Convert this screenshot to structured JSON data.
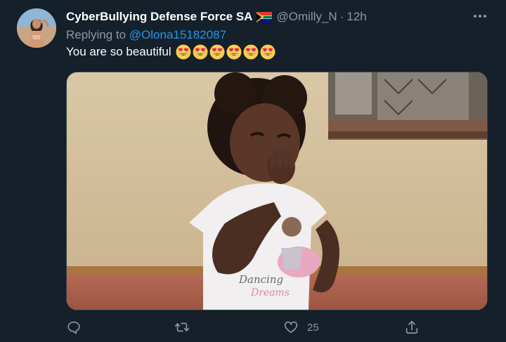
{
  "tweet": {
    "display_name": "CyberBullying Defense Force SA",
    "flag_icon": "south-africa-flag-icon",
    "handle": "@Omilly_N",
    "separator": "·",
    "time": "12h",
    "replying_prefix": "Replying to",
    "replying_to": "@Olona15182087",
    "text": "You are so beautiful",
    "emoji_icon": "heart-eyes-emoji",
    "emoji_count": 6,
    "media_icon": "photo-child-blowing-kiss",
    "actions": {
      "reply_icon": "reply-icon",
      "retweet_icon": "retweet-icon",
      "like_icon": "heart-icon",
      "like_count": "25",
      "share_icon": "share-icon"
    }
  },
  "colors": {
    "background": "#15202b",
    "secondary_text": "#8b98a5",
    "link": "#1d9bf0",
    "border": "#38444d"
  }
}
